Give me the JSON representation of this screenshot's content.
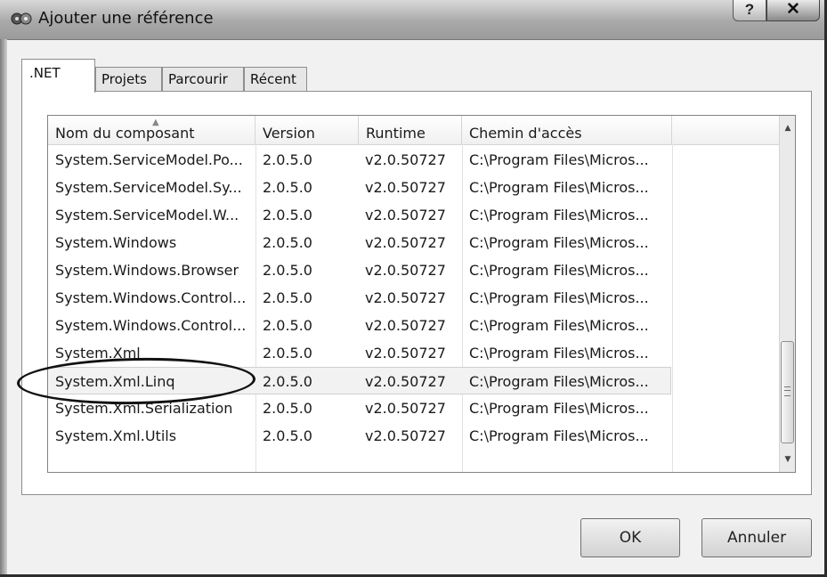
{
  "window": {
    "title": "Ajouter une référence",
    "icon": "components-icon",
    "help_label": "?",
    "close_label": "✕"
  },
  "tabs": [
    {
      "label": ".NET",
      "active": true
    },
    {
      "label": "Projets",
      "active": false
    },
    {
      "label": "Parcourir",
      "active": false
    },
    {
      "label": "Récent",
      "active": false
    }
  ],
  "list": {
    "columns": [
      "Nom du composant",
      "Version",
      "Runtime",
      "Chemin d'accès"
    ],
    "sorted_column": "Nom du composant",
    "rows": [
      {
        "name": "System.ServiceModel.Po...",
        "version": "2.0.5.0",
        "runtime": "v2.0.50727",
        "path": "C:\\Program Files\\Micros..."
      },
      {
        "name": "System.ServiceModel.Sy...",
        "version": "2.0.5.0",
        "runtime": "v2.0.50727",
        "path": "C:\\Program Files\\Micros..."
      },
      {
        "name": "System.ServiceModel.W...",
        "version": "2.0.5.0",
        "runtime": "v2.0.50727",
        "path": "C:\\Program Files\\Micros..."
      },
      {
        "name": "System.Windows",
        "version": "2.0.5.0",
        "runtime": "v2.0.50727",
        "path": "C:\\Program Files\\Micros..."
      },
      {
        "name": "System.Windows.Browser",
        "version": "2.0.5.0",
        "runtime": "v2.0.50727",
        "path": "C:\\Program Files\\Micros..."
      },
      {
        "name": "System.Windows.Control...",
        "version": "2.0.5.0",
        "runtime": "v2.0.50727",
        "path": "C:\\Program Files\\Micros..."
      },
      {
        "name": "System.Windows.Control...",
        "version": "2.0.5.0",
        "runtime": "v2.0.50727",
        "path": "C:\\Program Files\\Micros..."
      },
      {
        "name": "System.Xml",
        "version": "2.0.5.0",
        "runtime": "v2.0.50727",
        "path": "C:\\Program Files\\Micros..."
      },
      {
        "name": "System.Xml.Linq",
        "version": "2.0.5.0",
        "runtime": "v2.0.50727",
        "path": "C:\\Program Files\\Micros...",
        "selected": true
      },
      {
        "name": "System.Xml.Serialization",
        "version": "2.0.5.0",
        "runtime": "v2.0.50727",
        "path": "C:\\Program Files\\Micros..."
      },
      {
        "name": "System.Xml.Utils",
        "version": "2.0.5.0",
        "runtime": "v2.0.50727",
        "path": "C:\\Program Files\\Micros..."
      }
    ],
    "highlighted_row": "System.Xml.Linq",
    "scrollbar": {
      "thumb_position_fraction": 0.68,
      "thumb_size_fraction": 0.31
    }
  },
  "buttons": {
    "ok_label": "OK",
    "cancel_label": "Annuler"
  }
}
